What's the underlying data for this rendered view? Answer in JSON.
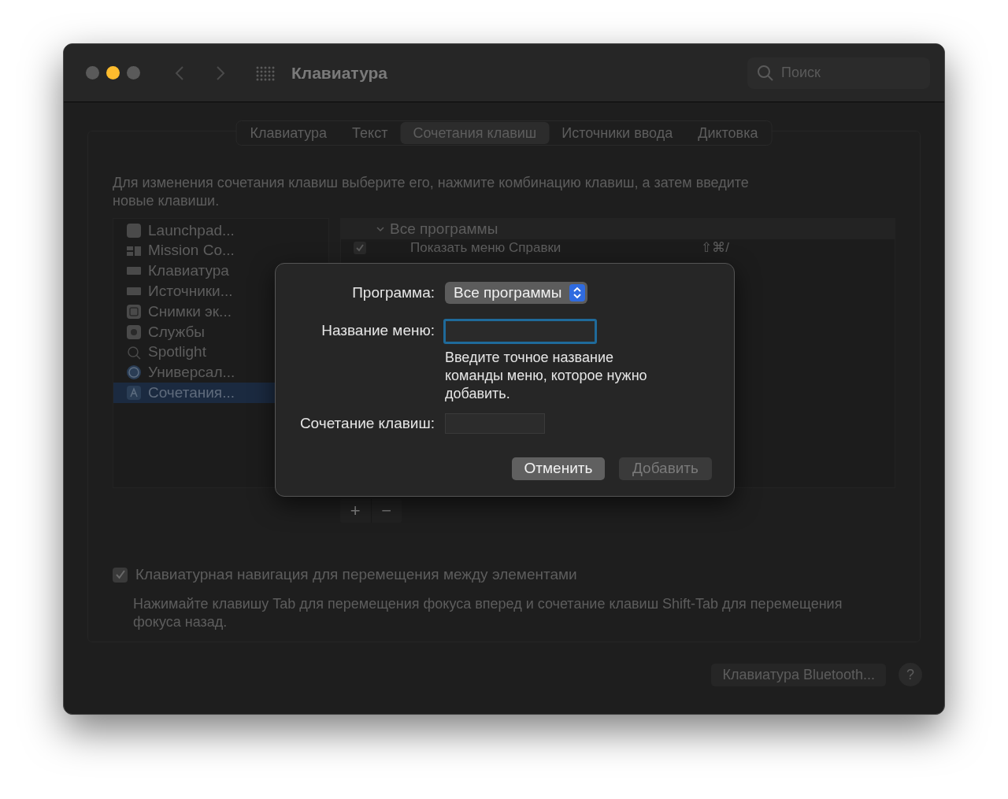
{
  "window": {
    "title": "Клавиатура"
  },
  "search": {
    "placeholder": "Поиск"
  },
  "tabs": [
    {
      "label": "Клавиатура",
      "selected": false
    },
    {
      "label": "Текст",
      "selected": false
    },
    {
      "label": "Сочетания клавиш",
      "selected": true
    },
    {
      "label": "Источники ввода",
      "selected": false
    },
    {
      "label": "Диктовка",
      "selected": false
    }
  ],
  "instructions": "Для изменения сочетания клавиш выберите его, нажмите комбинацию клавиш, а затем введите новые клавиши.",
  "sidebar": {
    "items": [
      {
        "label": "Launchpad...",
        "selected": false
      },
      {
        "label": "Mission Co...",
        "selected": false
      },
      {
        "label": "Клавиатура",
        "selected": false
      },
      {
        "label": "Источники...",
        "selected": false
      },
      {
        "label": "Снимки эк...",
        "selected": false
      },
      {
        "label": "Службы",
        "selected": false
      },
      {
        "label": "Spotlight",
        "selected": false
      },
      {
        "label": "Универсал...",
        "selected": false
      },
      {
        "label": "Сочетания...",
        "selected": true
      }
    ]
  },
  "shortcuts": {
    "groups": [
      {
        "label": "Все программы",
        "expanded": true,
        "children": [
          {
            "label": "Показать меню Справки",
            "shortcut": "⇧⌘/",
            "checked": true
          }
        ]
      }
    ]
  },
  "list_buttons": [
    {
      "label": "+",
      "disabled": false
    },
    {
      "label": "−",
      "disabled": true
    }
  ],
  "keyboard_navigation": {
    "label": "Клавиатурная навигация для перемещения между элементами",
    "checked": true,
    "description": "Нажимайте клавишу Tab для перемещения фокуса вперед и сочетание клавиш Shift-Tab для перемещения фокуса назад."
  },
  "bluetooth_button": "Клавиатура Bluetooth...",
  "help_button": "?",
  "dialog": {
    "program_label": "Программа:",
    "program_value": "Все программы",
    "menu_label": "Название меню:",
    "menu_hint": "Введите точное название команды меню, которое нужно добавить.",
    "shortcut_label": "Сочетание клавиш:",
    "buttons": [
      {
        "label": "Отменить",
        "disabled": false
      },
      {
        "label": "Добавить",
        "disabled": true
      }
    ]
  }
}
